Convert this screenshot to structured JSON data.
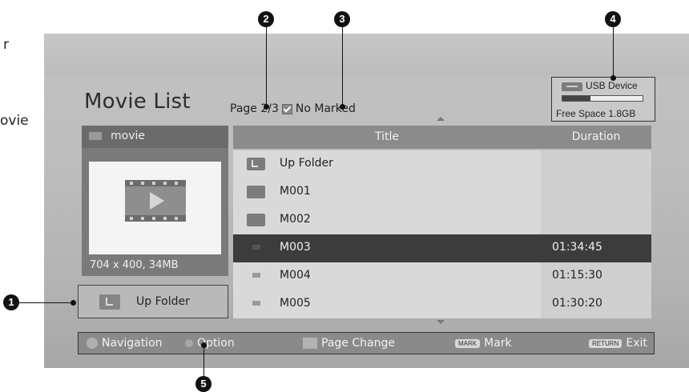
{
  "side_fragments": [
    "r",
    "ovie"
  ],
  "header": {
    "title": "Movie List",
    "page": "Page 2/3",
    "marked": "No Marked"
  },
  "usb": {
    "label": "USB Device",
    "free": "Free Space 1.8GB",
    "usage_fraction": 0.35
  },
  "preview": {
    "folder": "movie",
    "info": "704 x 400, 34MB"
  },
  "up_folder_button": "Up Folder",
  "list": {
    "columns": [
      "Title",
      "Duration"
    ],
    "rows": [
      {
        "name": "Up Folder",
        "duration": "",
        "icon": "up-folder-icon"
      },
      {
        "name": "M001",
        "duration": "",
        "icon": "folder-icon"
      },
      {
        "name": "M002",
        "duration": "",
        "icon": "folder-icon"
      },
      {
        "name": "M003",
        "duration": "01:34:45",
        "icon": "movie-file-icon",
        "selected": true
      },
      {
        "name": "M004",
        "duration": "01:15:30",
        "icon": "movie-file-icon"
      },
      {
        "name": "M005",
        "duration": "01:30:20",
        "icon": "movie-file-icon"
      }
    ]
  },
  "bottom_bar": {
    "navigation": "Navigation",
    "option": "Option",
    "page_change": "Page Change",
    "mark_key": "MARK",
    "mark": "Mark",
    "return_key": "RETURN",
    "exit": "Exit"
  },
  "callouts": [
    "1",
    "2",
    "3",
    "4",
    "5"
  ]
}
